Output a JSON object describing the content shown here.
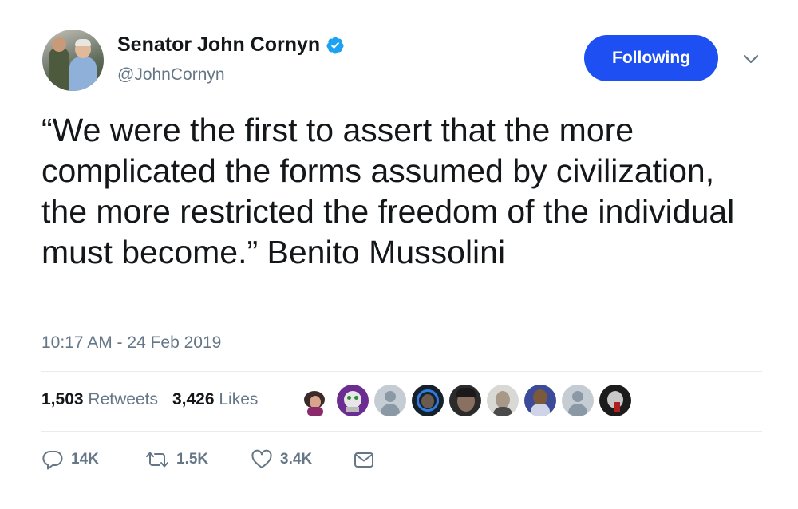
{
  "author": {
    "display_name": "Senator John Cornyn",
    "handle": "@JohnCornyn"
  },
  "follow_button": {
    "label": "Following"
  },
  "tweet": {
    "text": "“We were the first to assert that the more complicated the forms assumed by civilization, the more restricted the freedom of the individual must become.” Benito Mussolini",
    "timestamp": "10:17 AM - 24 Feb 2019"
  },
  "stats": {
    "retweets_count": "1,503",
    "retweets_label": "Retweets",
    "likes_count": "3,426",
    "likes_label": "Likes"
  },
  "actions": {
    "replies": "14K",
    "retweets": "1.5K",
    "likes": "3.4K"
  },
  "colors": {
    "accent": "#1d4ff2",
    "verified": "#1da1f2",
    "muted": "#657786",
    "text": "#14171a"
  },
  "icons": [
    "verified-badge-icon",
    "chevron-down-icon",
    "reply-icon",
    "retweet-icon",
    "like-icon",
    "direct-message-icon"
  ]
}
